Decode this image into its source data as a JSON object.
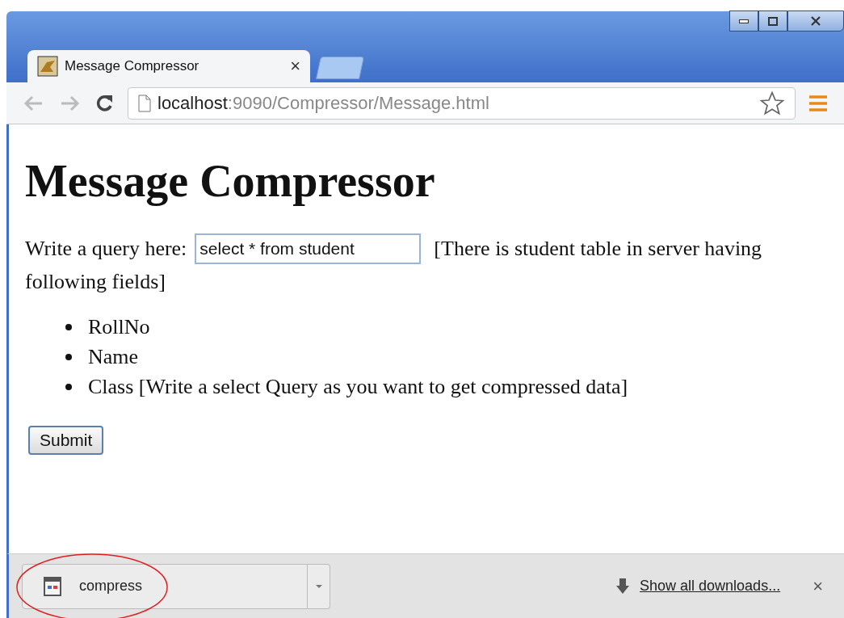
{
  "tabs": [
    {
      "title": "Message Compressor",
      "close": "×",
      "selected": true,
      "kind": "page"
    },
    {
      "selected": false,
      "kind": "new"
    }
  ],
  "toolbar": {
    "url": {
      "host": "localhost",
      "path": ":9090/Compressor/Message.html"
    }
  },
  "page": {
    "heading": "Message Compressor",
    "query_label": "Write a query here:",
    "query_value": "select * from student",
    "note_lines": [
      "[There is student table in server having",
      "following fields]"
    ],
    "fields": [
      "RollNo",
      "Name",
      "Class [Write a select Query as you want to get compressed data]"
    ],
    "submit": "Submit"
  },
  "downloads": {
    "items": [
      {
        "name": "compress",
        "highlighted": true
      }
    ],
    "show_all": "Show all downloads...",
    "close": "×"
  }
}
